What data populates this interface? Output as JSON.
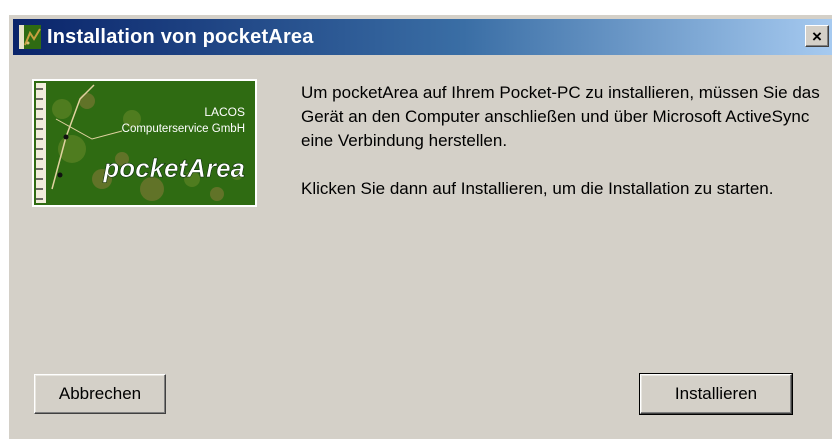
{
  "window": {
    "title": "Installation von pocketArea",
    "close_label": "×"
  },
  "logo": {
    "company_line1": "LACOS",
    "company_line2": "Computerservice GmbH",
    "product": "pocketArea",
    "background_color": "#2f6b12"
  },
  "message": {
    "paragraph1": "Um pocketArea auf Ihrem Pocket-PC zu installieren, müssen Sie das Gerät an den Computer anschließen und über Microsoft ActiveSync eine Verbindung herstellen.",
    "paragraph2": "Klicken Sie dann auf Installieren, um die Installation zu starten."
  },
  "buttons": {
    "cancel_label": "Abbrechen",
    "install_label": "Installieren"
  }
}
